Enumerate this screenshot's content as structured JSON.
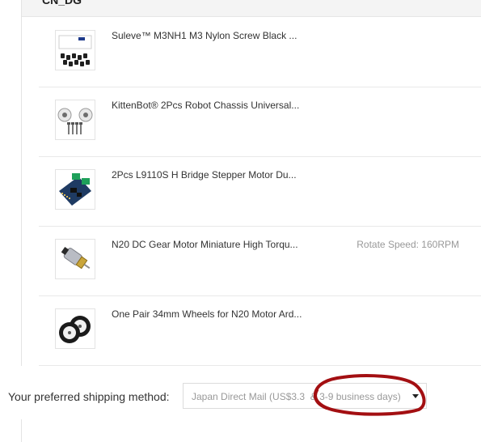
{
  "group": {
    "title": "CN_DG"
  },
  "items": [
    {
      "title": "Suleve™ M3NH1 M3 Nylon Screw Black ...",
      "attribute": "",
      "image": "screw-kit-box"
    },
    {
      "title": "KittenBot® 2Pcs Robot Chassis Universal...",
      "attribute": "",
      "image": "caster-wheels"
    },
    {
      "title": "2Pcs L9110S H Bridge Stepper Motor Du...",
      "attribute": "",
      "image": "motor-driver-board"
    },
    {
      "title": "N20 DC Gear Motor Miniature High Torqu...",
      "attribute": "Rotate Speed: 160RPM",
      "image": "gear-motor"
    },
    {
      "title": "One Pair 34mm Wheels for N20 Motor Ard...",
      "attribute": "",
      "image": "wheels"
    }
  ],
  "shipping": {
    "label": "Your preferred shipping method:",
    "selected": "Japan Direct Mail (US$3.3  & 3-9 business days)"
  },
  "colors": {
    "annotation": "#a30f12"
  }
}
